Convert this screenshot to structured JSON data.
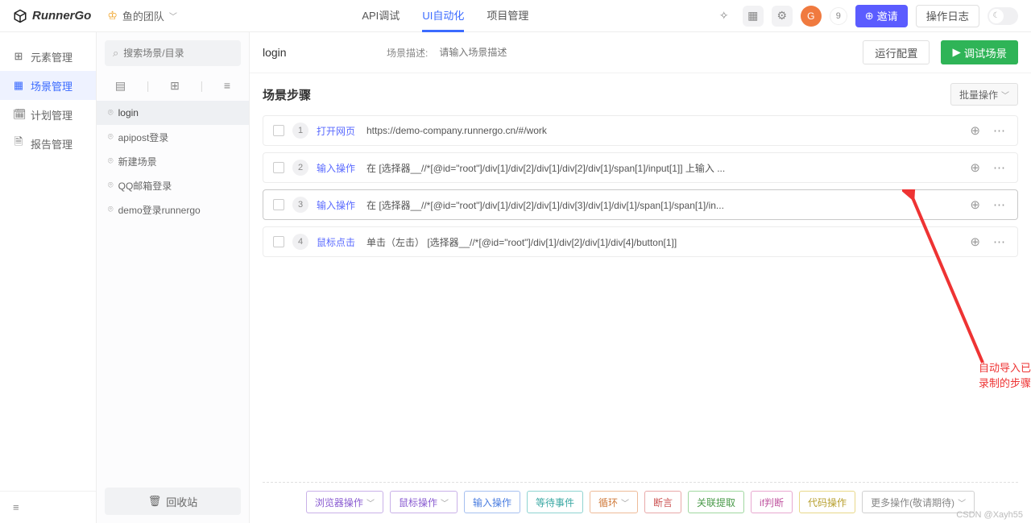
{
  "brand": "RunnerGo",
  "team": {
    "name": "鱼的团队"
  },
  "nav": {
    "api": "API调试",
    "ui": "UI自动化",
    "project": "项目管理"
  },
  "topright": {
    "count": "9",
    "invite": "邀请",
    "log": "操作日志"
  },
  "sidebar": {
    "items": [
      {
        "label": "元素管理",
        "icon": "⊞"
      },
      {
        "label": "场景管理",
        "icon": "▦"
      },
      {
        "label": "计划管理",
        "icon": "🗓"
      },
      {
        "label": "报告管理",
        "icon": "🗎"
      }
    ]
  },
  "search": {
    "placeholder": "搜索场景/目录"
  },
  "scenes": [
    {
      "label": "login"
    },
    {
      "label": "apipost登录"
    },
    {
      "label": "新建场景"
    },
    {
      "label": "QQ邮箱登录"
    },
    {
      "label": "demo登录runnergo"
    }
  ],
  "recycle": "回收站",
  "head": {
    "title": "login",
    "desc_label": "场景描述:",
    "desc_placeholder": "请输入场景描述",
    "config": "运行配置",
    "debug": "调试场景"
  },
  "steps_section": {
    "title": "场景步骤",
    "batch": "批量操作"
  },
  "steps": [
    {
      "n": "1",
      "type": "打开网页",
      "desc": "https://demo-company.runnergo.cn/#/work"
    },
    {
      "n": "2",
      "type": "输入操作",
      "desc": "在 [选择器__//*[@id=\"root\"]/div[1]/div[2]/div[1]/div[2]/div[1]/span[1]/input[1]] 上输入 ..."
    },
    {
      "n": "3",
      "type": "输入操作",
      "desc": "在 [选择器__//*[@id=\"root\"]/div[1]/div[2]/div[1]/div[3]/div[1]/div[1]/span[1]/span[1]/in..."
    },
    {
      "n": "4",
      "type": "鼠标点击",
      "desc": "单击（左击） [选择器__//*[@id=\"root\"]/div[1]/div[2]/div[1]/div[4]/button[1]]"
    }
  ],
  "annotation": "自动导入已录制的步骤",
  "bottom": {
    "browser": "浏览器操作",
    "mouse": "鼠标操作",
    "input": "输入操作",
    "wait": "等待事件",
    "loop": "循环",
    "assert": "断言",
    "extract": "关联提取",
    "if": "if判断",
    "code": "代码操作",
    "more": "更多操作(敬请期待)"
  },
  "watermark": "CSDN @Xayh55"
}
